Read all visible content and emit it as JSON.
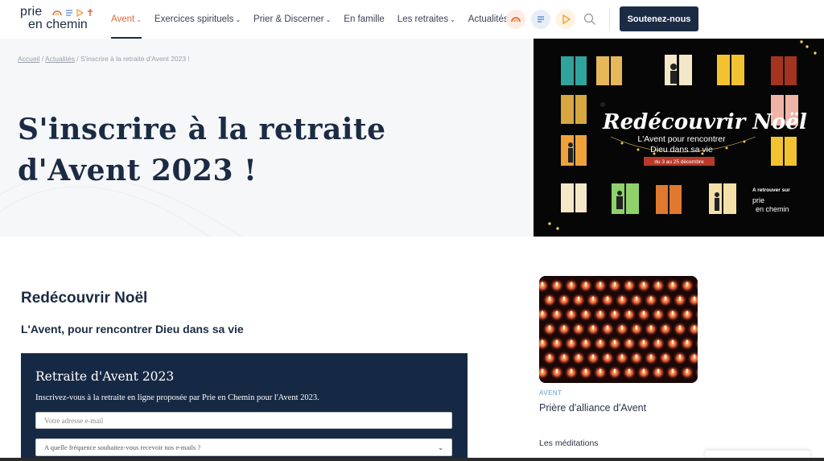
{
  "logo": {
    "line1": "prie",
    "line2": "en chemin"
  },
  "nav": [
    {
      "label": "Avent",
      "chevron": "⌄",
      "active": true
    },
    {
      "label": "Exercices spirituels",
      "chevron": "⌄"
    },
    {
      "label": "Prier & Discerner",
      "chevron": "⌄"
    },
    {
      "label": "En famille",
      "chevron": ""
    },
    {
      "label": "Les retraites",
      "chevron": "⌄"
    },
    {
      "label": "Actualités",
      "chevron": ""
    }
  ],
  "header_icons": [
    "rainbow-icon",
    "lines-icon",
    "play-icon",
    "search-icon"
  ],
  "support_button": "Soutenez-nous",
  "breadcrumb": {
    "home": "Accueil",
    "sep": " / ",
    "section": "Actualités",
    "current": "S'inscrire à la retraite d'Avent 2023 !"
  },
  "page_title_line1": "S'inscrire à la retraite",
  "page_title_line2": "d'Avent 2023 !",
  "hero_image": {
    "title": "Redécouvrir Noël",
    "subtitle_line1": "L'Avent pour rencontrer",
    "subtitle_line2": "Dieu dans sa vie",
    "dates": "du 3 au 25 décembre",
    "find_on": "A retrouver sur",
    "logo_line1": "prie",
    "logo_line2": "en chemin"
  },
  "content": {
    "heading": "Redécouvrir Noël",
    "subheading": "L'Avent, pour rencontrer Dieu dans sa vie"
  },
  "form": {
    "title": "Retraite d'Avent 2023",
    "text": "Inscrivez-vous à la retraite en ligne proposée par Prie en Chemin pour l'Avent 2023.",
    "email_placeholder": "Votre adresse e-mail",
    "frequency_select": "A quelle fréquence souhaitez-vous recevoir nos e-mails ?"
  },
  "sidebar": {
    "tag": "AVENT",
    "card_title": "Prière d'alliance d'Avent",
    "section_title": "Les méditations"
  },
  "colors": {
    "navy": "#1c2b44",
    "accent": "#e2673b",
    "form_bg": "#162944"
  }
}
